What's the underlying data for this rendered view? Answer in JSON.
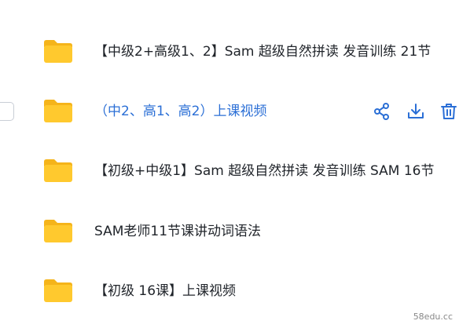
{
  "files": [
    {
      "name": "【中级2+高级1、2】Sam 超级自然拼读 发音训练 21节",
      "selected": false
    },
    {
      "name": "（中2、高1、高2）上课视频",
      "selected": true
    },
    {
      "name": "【初级+中级1】Sam 超级自然拼读 发音训练 SAM 16节",
      "selected": false
    },
    {
      "name": "SAM老师11节课讲动词语法",
      "selected": false
    },
    {
      "name": "【初级 16课】上课视频",
      "selected": false
    }
  ],
  "row_actions": {
    "share_icon": "share-icon",
    "download_icon": "download-icon",
    "delete_icon": "trash-icon"
  },
  "watermark": "58edu.cc",
  "colors": {
    "folder": "#ffc92e",
    "folder_tab": "#f5b41a",
    "selected_text": "#2b6fd6",
    "action_icon": "#2b6fd6",
    "text": "#1f2329"
  }
}
